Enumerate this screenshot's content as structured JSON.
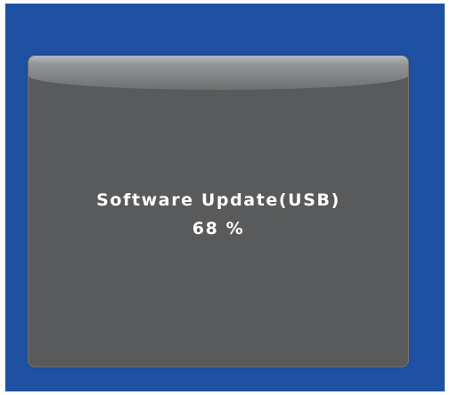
{
  "dialog": {
    "title": "Software Update(USB)",
    "progress_text": "68 %",
    "progress_percent": 68
  },
  "colors": {
    "screen_background": "#1f51a3",
    "dialog_background": "#585a5b",
    "text": "#ffffff"
  }
}
